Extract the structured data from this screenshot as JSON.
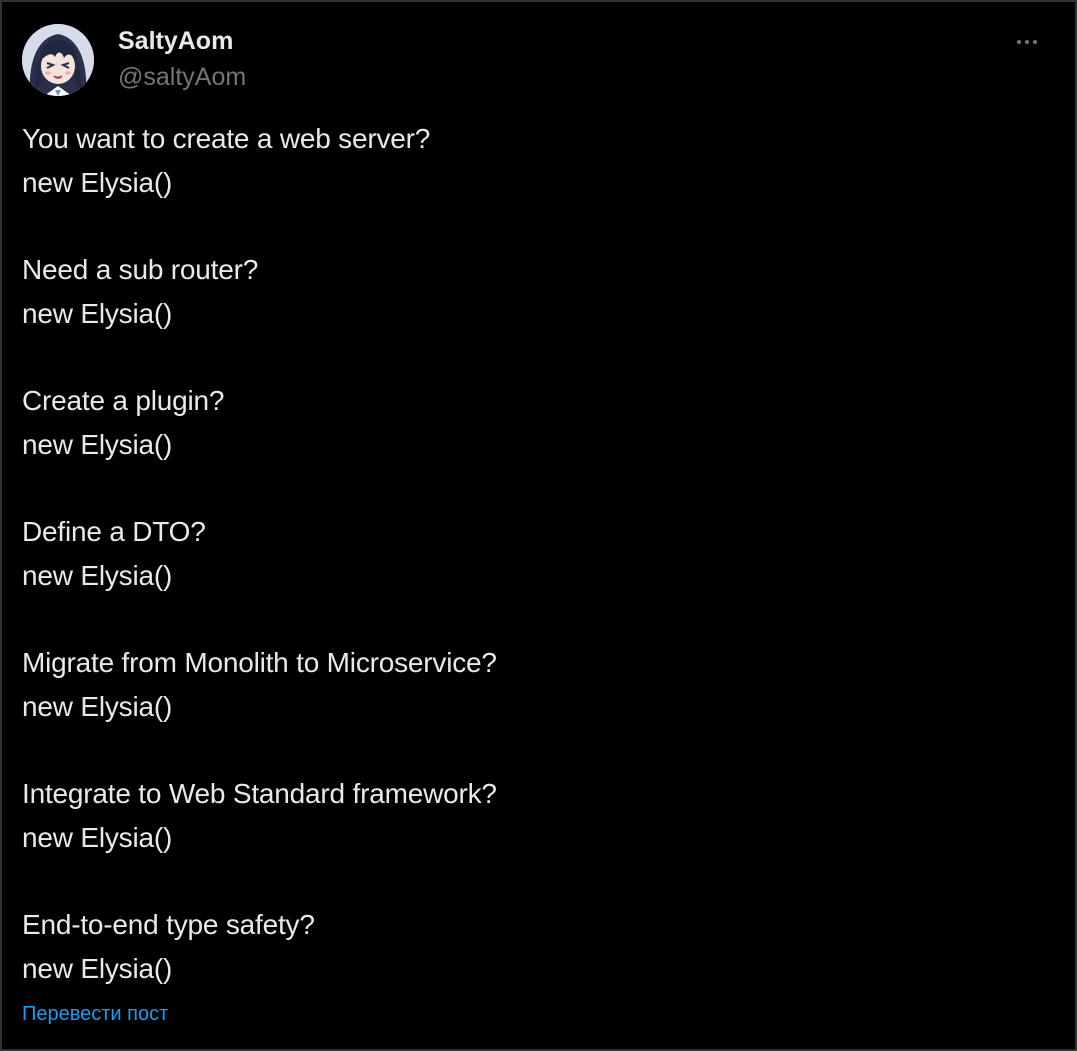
{
  "author": {
    "display_name": "SaltyAom",
    "handle": "@saltyAom",
    "avatar_icon": "anime-avatar-icon"
  },
  "more_icon": "more-horizontal-icon",
  "tweet": {
    "blocks": [
      {
        "question": "You want to create a web server?",
        "answer": "new Elysia()"
      },
      {
        "question": "Need a sub router?",
        "answer": "new Elysia()"
      },
      {
        "question": "Create a plugin?",
        "answer": "new Elysia()"
      },
      {
        "question": "Define a DTO?",
        "answer": "new Elysia()"
      },
      {
        "question": "Migrate from Monolith to Microservice?",
        "answer": "new Elysia()"
      },
      {
        "question": "Integrate to Web Standard framework?",
        "answer": "new Elysia()"
      },
      {
        "question": "End-to-end type safety?",
        "answer": "new Elysia()"
      }
    ]
  },
  "translate_label": "Перевести пост",
  "colors": {
    "background": "#000000",
    "text": "#e7e9ea",
    "muted": "#71767b",
    "link": "#1d9bf0",
    "border": "#2f3336"
  }
}
